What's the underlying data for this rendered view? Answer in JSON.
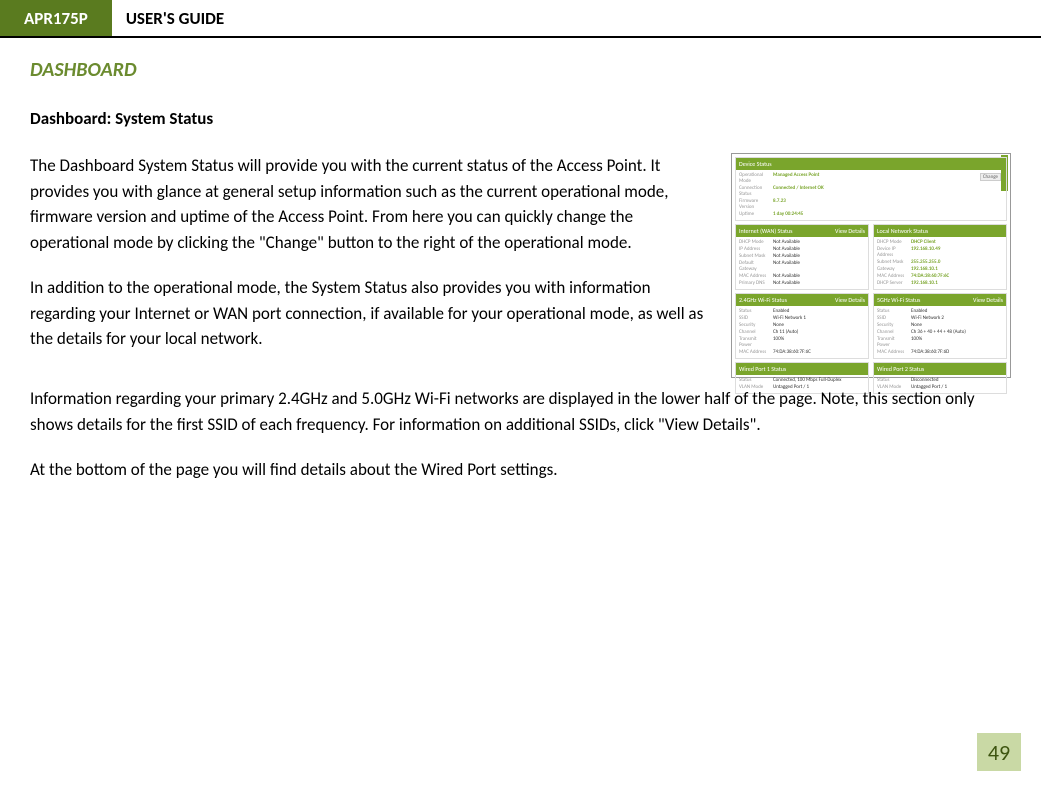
{
  "header": {
    "product": "APR175P",
    "title": "USER'S GUIDE"
  },
  "section": {
    "title": "DASHBOARD",
    "subtitle": "Dashboard: System Status"
  },
  "paragraphs": {
    "p1": "The Dashboard System Status will provide you with the current status of the Access Point.  It provides you with glance at general setup information such as the current operational mode, firmware version and uptime of the Access Point.  From here you can quickly change the operational mode by clicking the \"Change\" button to the right of the operational mode.",
    "p2": "In addition to the operational mode, the System Status also provides you with information regarding your Internet or WAN port connection, if available for your operational mode, as well as the details for your local network.",
    "p3": "Information regarding your primary 2.4GHz and 5.0GHz Wi-Fi networks are displayed in the lower half of the page.  Note, this section only shows details for the first SSID of each frequency.  For information on additional SSIDs, click \"View Details\".",
    "p4": "At the bottom of the page you will find details about the Wired Port settings."
  },
  "figure": {
    "device_status": {
      "title": "Device Status",
      "change_btn": "Change",
      "rows": [
        {
          "label": "Operational Mode",
          "value": "Managed Access Point"
        },
        {
          "label": "Connection Status",
          "value": "Connected / Internet OK"
        },
        {
          "label": "Firmware Version",
          "value": "8.7.23"
        },
        {
          "label": "Uptime",
          "value": "1 day 00:24:45"
        }
      ]
    },
    "internet_status": {
      "title": "Internet (WAN) Status",
      "view_details": "View Details",
      "rows": [
        {
          "label": "DHCP Mode",
          "value": "Not Available"
        },
        {
          "label": "IP Address",
          "value": "Not Available"
        },
        {
          "label": "Subnet Mask",
          "value": "Not Available"
        },
        {
          "label": "Default Gateway",
          "value": "Not Available"
        },
        {
          "label": "MAC Address",
          "value": "Not Available"
        },
        {
          "label": "Primary DNS",
          "value": "Not Available"
        }
      ]
    },
    "local_network": {
      "title": "Local Network Status",
      "rows": [
        {
          "label": "DHCP Mode",
          "value": "DHCP Client"
        },
        {
          "label": "Device IP Address",
          "value": "192.168.10.49"
        },
        {
          "label": "Subnet Mask",
          "value": "255.255.255.0"
        },
        {
          "label": "Gateway",
          "value": "192.168.10.1"
        },
        {
          "label": "MAC Address",
          "value": "74:DA:38:60:7F:6C"
        },
        {
          "label": "DHCP Server",
          "value": "192.168.10.1"
        }
      ]
    },
    "wifi_24": {
      "title": "2.4GHz Wi-Fi Status",
      "view_details": "View Details",
      "rows": [
        {
          "label": "Status",
          "value": "Enabled"
        },
        {
          "label": "SSID",
          "value": "Wi-Fi Network 1"
        },
        {
          "label": "Security",
          "value": "None"
        },
        {
          "label": "Channel",
          "value": "Ch 11 (Auto)"
        },
        {
          "label": "Transmit Power",
          "value": "100%"
        },
        {
          "label": "MAC Address",
          "value": "74:DA:38:60:7F:6C"
        }
      ]
    },
    "wifi_50": {
      "title": "5GHz Wi-Fi Status",
      "view_details": "View Details",
      "rows": [
        {
          "label": "Status",
          "value": "Enabled"
        },
        {
          "label": "SSID",
          "value": "Wi-Fi Network 2"
        },
        {
          "label": "Security",
          "value": "None"
        },
        {
          "label": "Channel",
          "value": "Ch 36 + 40 + 44 + 48 (Auto)"
        },
        {
          "label": "Transmit Power",
          "value": "100%"
        },
        {
          "label": "MAC Address",
          "value": "74:DA:38:60:7F:6D"
        }
      ]
    },
    "wired1": {
      "title": "Wired Port 1 Status",
      "rows": [
        {
          "label": "Status",
          "value": "Connected, 100 Mbps Full-Duplex"
        },
        {
          "label": "VLAN Mode",
          "value": "Untagged Port / 1"
        }
      ]
    },
    "wired2": {
      "title": "Wired Port 2 Status",
      "rows": [
        {
          "label": "Status",
          "value": "Disconnected"
        },
        {
          "label": "VLAN Mode",
          "value": "Untagged Port / 1"
        }
      ]
    }
  },
  "page_number": "49"
}
